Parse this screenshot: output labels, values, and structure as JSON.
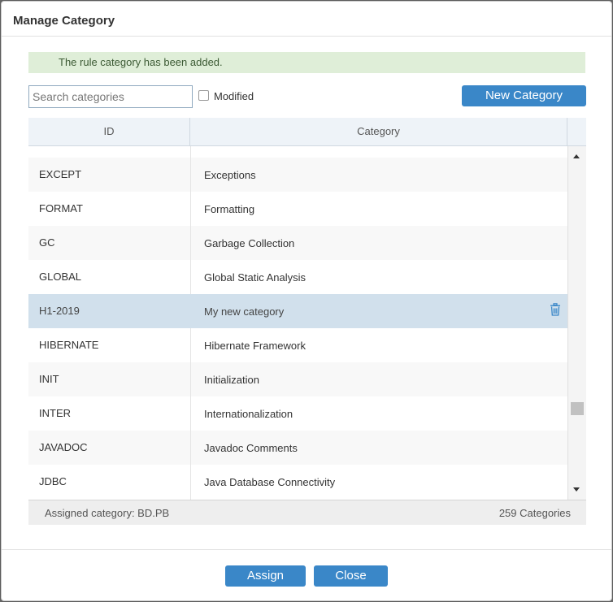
{
  "dialog": {
    "title": "Manage Category",
    "alert": "The rule category has been added.",
    "search": {
      "placeholder": "Search categories",
      "value": ""
    },
    "modified_label": "Modified",
    "new_category_label": "New Category",
    "columns": {
      "id": "ID",
      "category": "Category"
    },
    "rows": [
      {
        "id": "EXCEPT",
        "category": "Exceptions"
      },
      {
        "id": "FORMAT",
        "category": "Formatting"
      },
      {
        "id": "GC",
        "category": "Garbage Collection"
      },
      {
        "id": "GLOBAL",
        "category": "Global Static Analysis"
      },
      {
        "id": "H1-2019",
        "category": "My new category"
      },
      {
        "id": "HIBERNATE",
        "category": "Hibernate Framework"
      },
      {
        "id": "INIT",
        "category": "Initialization"
      },
      {
        "id": "INTER",
        "category": "Internationalization"
      },
      {
        "id": "JAVADOC",
        "category": "Javadoc Comments"
      },
      {
        "id": "JDBC",
        "category": "Java Database Connectivity"
      }
    ],
    "selected_row_icon": "trash-icon",
    "footer": {
      "assigned": "Assigned category: BD.PB",
      "count": "259 Categories"
    },
    "buttons": {
      "assign": "Assign",
      "close": "Close"
    },
    "colors": {
      "primary": "#3a87c8",
      "alert_bg": "#dfeed8",
      "selected_row": "#d1e0ec"
    }
  }
}
